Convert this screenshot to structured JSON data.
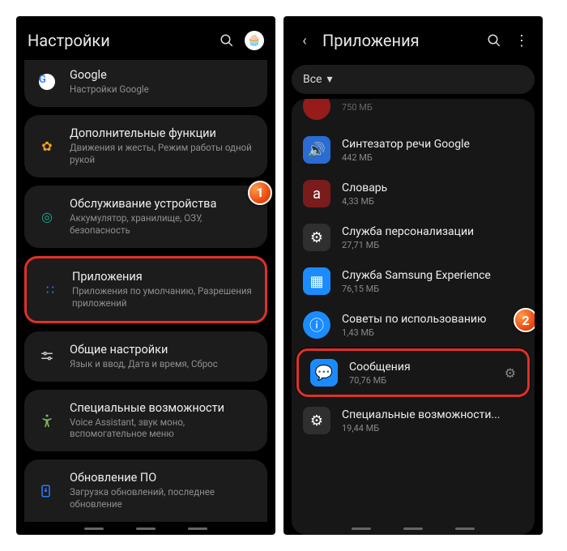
{
  "left": {
    "header": {
      "title": "Настройки"
    },
    "items": [
      {
        "title": "Google",
        "sub": "Настройки Google"
      },
      {
        "title": "Дополнительные функции",
        "sub": "Движения и жесты, Режим работы одной рукой"
      },
      {
        "title": "Обслуживание устройства",
        "sub": "Аккумулятор, хранилище, ОЗУ, безопасность"
      },
      {
        "title": "Приложения",
        "sub": "Приложения по умолчанию, Разрешения приложений"
      },
      {
        "title": "Общие настройки",
        "sub": "Язык и ввод, Дата и время, Сброс"
      },
      {
        "title": "Специальные возможности",
        "sub": "Voice Assistant, звук моно, вспомогательное меню"
      },
      {
        "title": "Обновление ПО",
        "sub": "Загрузка обновлений, последнее обновление"
      }
    ],
    "badge1": "1"
  },
  "right": {
    "header": {
      "title": "Приложения"
    },
    "filter": "Все",
    "apps": [
      {
        "name": "",
        "size": "750 МБ",
        "color": "#cc1f1f"
      },
      {
        "name": "Синтезатор речи Google",
        "size": "442 МБ",
        "color": "#2a6bd4"
      },
      {
        "name": "Словарь",
        "size": "4,33 МБ",
        "color": "#7a1c1c"
      },
      {
        "name": "Служба персонализации",
        "size": "27,71 МБ",
        "color": "#2f2f2f"
      },
      {
        "name": "Служба Samsung Experience",
        "size": "76,15 МБ",
        "color": "#1a8cff"
      },
      {
        "name": "Советы по использованию",
        "size": "1,43 МБ",
        "color": "#1a8cff"
      },
      {
        "name": "Сообщения",
        "size": "70,76 МБ",
        "color": "#1a8cff"
      },
      {
        "name": "Специальные возможности...",
        "size": "19,44 МБ",
        "color": "#2f2f2f"
      }
    ],
    "badge2": "2"
  }
}
